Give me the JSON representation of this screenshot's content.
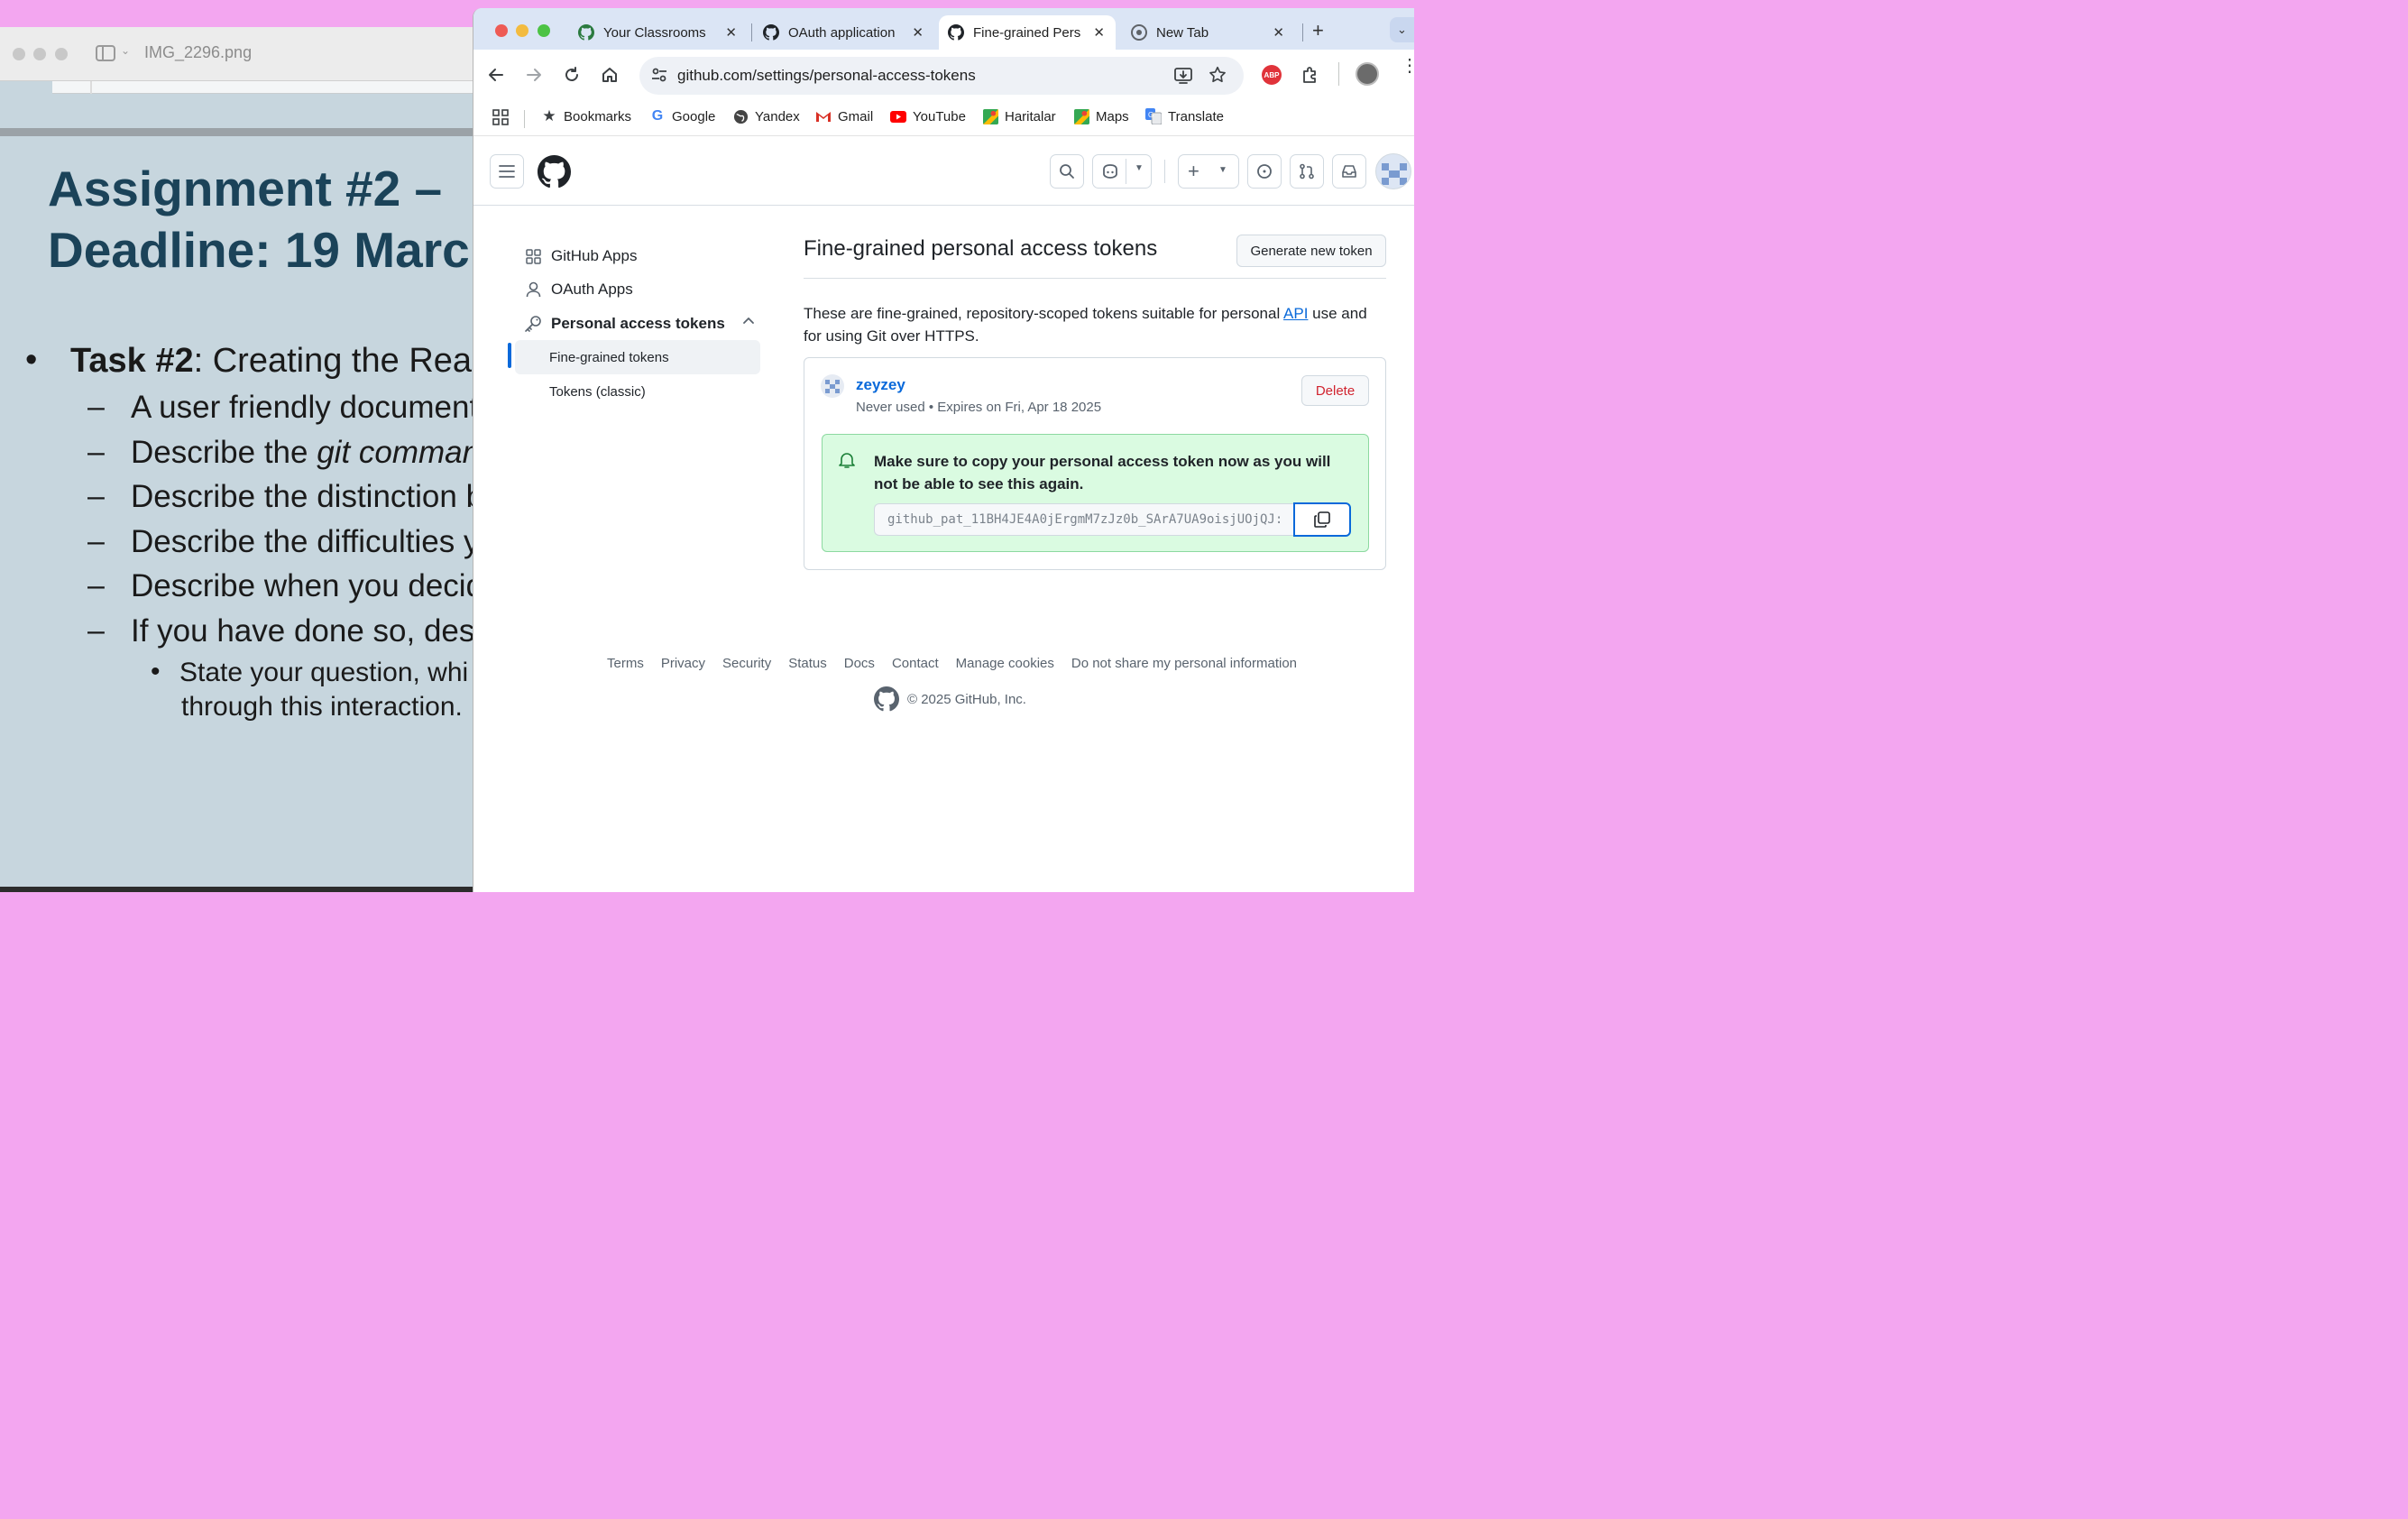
{
  "preview": {
    "title": "IMG_2296.png",
    "slide_title": "Assignment #2 –\nDeadline: 19 Marc",
    "task_label": "Task #2",
    "task_rest": ": Creating the Rea",
    "items": [
      "A user friendly document",
      "git comman",
      "Describe the distinction b",
      "Describe the difficulties y",
      "Describe when you decid",
      "If you have done so, desc"
    ],
    "item_prefix": "Describe the ",
    "sub_item_line1": "State your question, whi",
    "sub_item_line2": "through this interaction."
  },
  "browser": {
    "tabs": [
      {
        "label": "Your Classrooms",
        "icon": "github-icon"
      },
      {
        "label": "OAuth application",
        "icon": "github-icon"
      },
      {
        "label": "Fine-grained Pers",
        "icon": "github-icon",
        "active": true
      },
      {
        "label": "New Tab",
        "icon": "chrome-icon"
      }
    ],
    "url": "github.com/settings/personal-access-tokens",
    "bookmarks": [
      "Bookmarks",
      "Google",
      "Yandex",
      "Gmail",
      "YouTube",
      "Haritalar",
      "Maps",
      "Translate"
    ],
    "extension_badge": "ABP"
  },
  "sidebar": {
    "items": [
      "GitHub Apps",
      "OAuth Apps",
      "Personal access tokens"
    ],
    "sub_items": [
      "Fine-grained tokens",
      "Tokens (classic)"
    ]
  },
  "main": {
    "title": "Fine-grained personal access tokens",
    "generate_label": "Generate new token",
    "intro_before": "These are fine-grained, repository-scoped tokens suitable for personal ",
    "intro_link": "API",
    "intro_after": " use and for using Git over HTTPS.",
    "token": {
      "name": "zeyzey",
      "meta": "Never used • Expires on Fri, Apr 18 2025",
      "delete_label": "Delete",
      "flash_message": "Make sure to copy your personal access token now as you will not be able to see this again.",
      "value": "github_pat_11BH4JE4A0jErgmM7zJz0b_SArA7UA9oisjUOjQJ:"
    }
  },
  "footer": {
    "links": [
      "Terms",
      "Privacy",
      "Security",
      "Status",
      "Docs",
      "Contact",
      "Manage cookies",
      "Do not share my personal information"
    ],
    "copyright": "© 2025 GitHub, Inc."
  },
  "colors": {
    "accent": "#0969da",
    "danger": "#d1242f",
    "success_bg": "#dafbe1",
    "slide_title": "#1b4359"
  }
}
